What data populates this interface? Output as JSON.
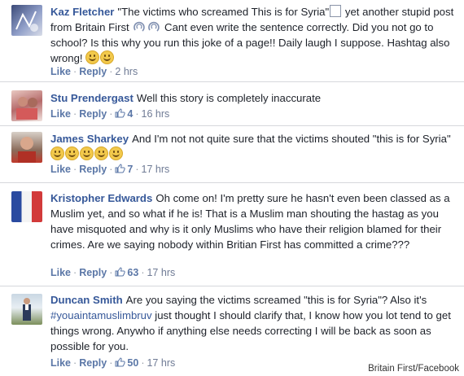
{
  "comments": [
    {
      "author": "Kaz Fletcher",
      "text_before": "\"The victims who screamed This is for Syria\"",
      "text_mid1": " yet another stupid post from Britain First",
      "text_mid2": " Cant even write the sentence correctly. Did you not go to school? Is this why you run this joke of a page!! Daily laugh I suppose. Hashtag also wrong!",
      "like_label": "Like",
      "reply_label": "Reply",
      "likes": "",
      "time": "2 hrs",
      "emoji_count": 2
    },
    {
      "author": "Stu Prendergast",
      "text": "Well this story is completely inaccurate",
      "like_label": "Like",
      "reply_label": "Reply",
      "likes": "4",
      "time": "16 hrs"
    },
    {
      "author": "James Sharkey",
      "text": "And I'm not not quite sure that the victims shouted \"this is for Syria\"",
      "like_label": "Like",
      "reply_label": "Reply",
      "likes": "7",
      "time": "17 hrs",
      "emoji_count": 5
    },
    {
      "author": "Kristopher Edwards",
      "text": "Oh come on! I'm pretty sure he hasn't even been classed as a Muslim yet, and so what if he is! That is a Muslim man shouting the hastag as you have misquoted and why is it only Muslims who have their religion blamed for their crimes. Are we saying nobody within Britian First has committed a crime???",
      "like_label": "Like",
      "reply_label": "Reply",
      "likes": "63",
      "time": "17 hrs"
    },
    {
      "author": "Duncan Smith",
      "text_before": "Are you saying the victims screamed \"this is for Syria\"? Also it's ",
      "hashtag": "#youaintamuslimbruv",
      "text_after": " just thought I should clarify that, I know how you lot tend to get things wrong. Anywho if anything else needs correcting I will be back as soon as possible for you.",
      "like_label": "Like",
      "reply_label": "Reply",
      "likes": "50",
      "time": "17 hrs"
    }
  ],
  "caption": "Britain First/Facebook",
  "colors": {
    "author": "#365899",
    "meta": "#6f7b95",
    "divider": "#d6d8dc"
  }
}
